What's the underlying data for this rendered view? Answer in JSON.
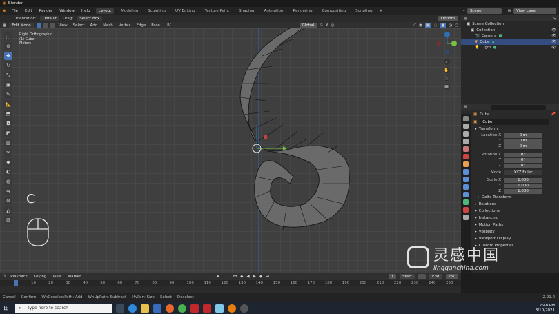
{
  "app": {
    "title": "Blender"
  },
  "menu": [
    "File",
    "Edit",
    "Render",
    "Window",
    "Help"
  ],
  "workspaces": [
    "Layout",
    "Modeling",
    "Sculpting",
    "UV Editing",
    "Texture Paint",
    "Shading",
    "Animation",
    "Rendering",
    "Compositing",
    "Scripting"
  ],
  "top_right": {
    "scene": "Scene",
    "view_layer": "View Layer"
  },
  "tool_header": {
    "orientation_label": "Orientation:",
    "orientation": "Default",
    "drag_label": "Drag:",
    "drag": "Select Box",
    "options": "Options"
  },
  "viewport_header": {
    "mode": "Edit Mode",
    "menus": [
      "View",
      "Select",
      "Add",
      "Mesh",
      "Vertex",
      "Edge",
      "Face",
      "UV"
    ],
    "transform": "Global"
  },
  "viewport_info": {
    "view": "Right Orthographic",
    "object": "(1) Cube",
    "units": "Meters"
  },
  "key_overlay": "C",
  "outliner": {
    "rows": [
      {
        "label": "Scene Collection",
        "indent": 0,
        "selected": false
      },
      {
        "label": "Collection",
        "indent": 1,
        "selected": false
      },
      {
        "label": "Camera",
        "indent": 2,
        "selected": false
      },
      {
        "label": "Cube",
        "indent": 2,
        "selected": true
      },
      {
        "label": "Light",
        "indent": 2,
        "selected": false
      }
    ]
  },
  "properties": {
    "object_name": "Cube",
    "data_name": "Cube",
    "transform_title": "Transform",
    "location": {
      "label": "Location X",
      "x": "0 m",
      "y": "0 m",
      "z": "0 m"
    },
    "rotation": {
      "label": "Rotation X",
      "x": "0°",
      "y": "0°",
      "z": "0°"
    },
    "mode": {
      "label": "Mode",
      "value": "XYZ Euler"
    },
    "scale": {
      "label": "Scale X",
      "x": "1.000",
      "y": "1.000",
      "z": "1.000"
    },
    "axis_y": "Y",
    "axis_z": "Z",
    "sections": [
      "Delta Transform",
      "Relations",
      "Collections",
      "Instancing",
      "Motion Paths",
      "Visibility",
      "Viewport Display",
      "Custom Properties"
    ]
  },
  "timeline": {
    "menus": [
      "Playback",
      "Keying",
      "View",
      "Marker"
    ],
    "current_frame": "1",
    "start_label": "Start",
    "start": "1",
    "end_label": "End",
    "end": "250",
    "ticks": [
      "1",
      "10",
      "20",
      "30",
      "40",
      "50",
      "60",
      "70",
      "80",
      "90",
      "100",
      "110",
      "120",
      "130",
      "140",
      "150",
      "160",
      "170",
      "180",
      "190",
      "200",
      "210",
      "220",
      "230",
      "240",
      "250"
    ]
  },
  "statusbar": {
    "items": [
      "Cancel",
      "Confirm",
      "WhDeselectPath: Add",
      "WhUpPath: Subtract",
      "MvPan: Size",
      "Select",
      "Deselect"
    ],
    "version": "2.91.0"
  },
  "taskbar": {
    "search_placeholder": "Type here to search",
    "time": "7:48 PM",
    "date": "3/10/2021"
  },
  "watermark": {
    "cn": "灵感中国",
    "url": "lingganchina.com"
  }
}
